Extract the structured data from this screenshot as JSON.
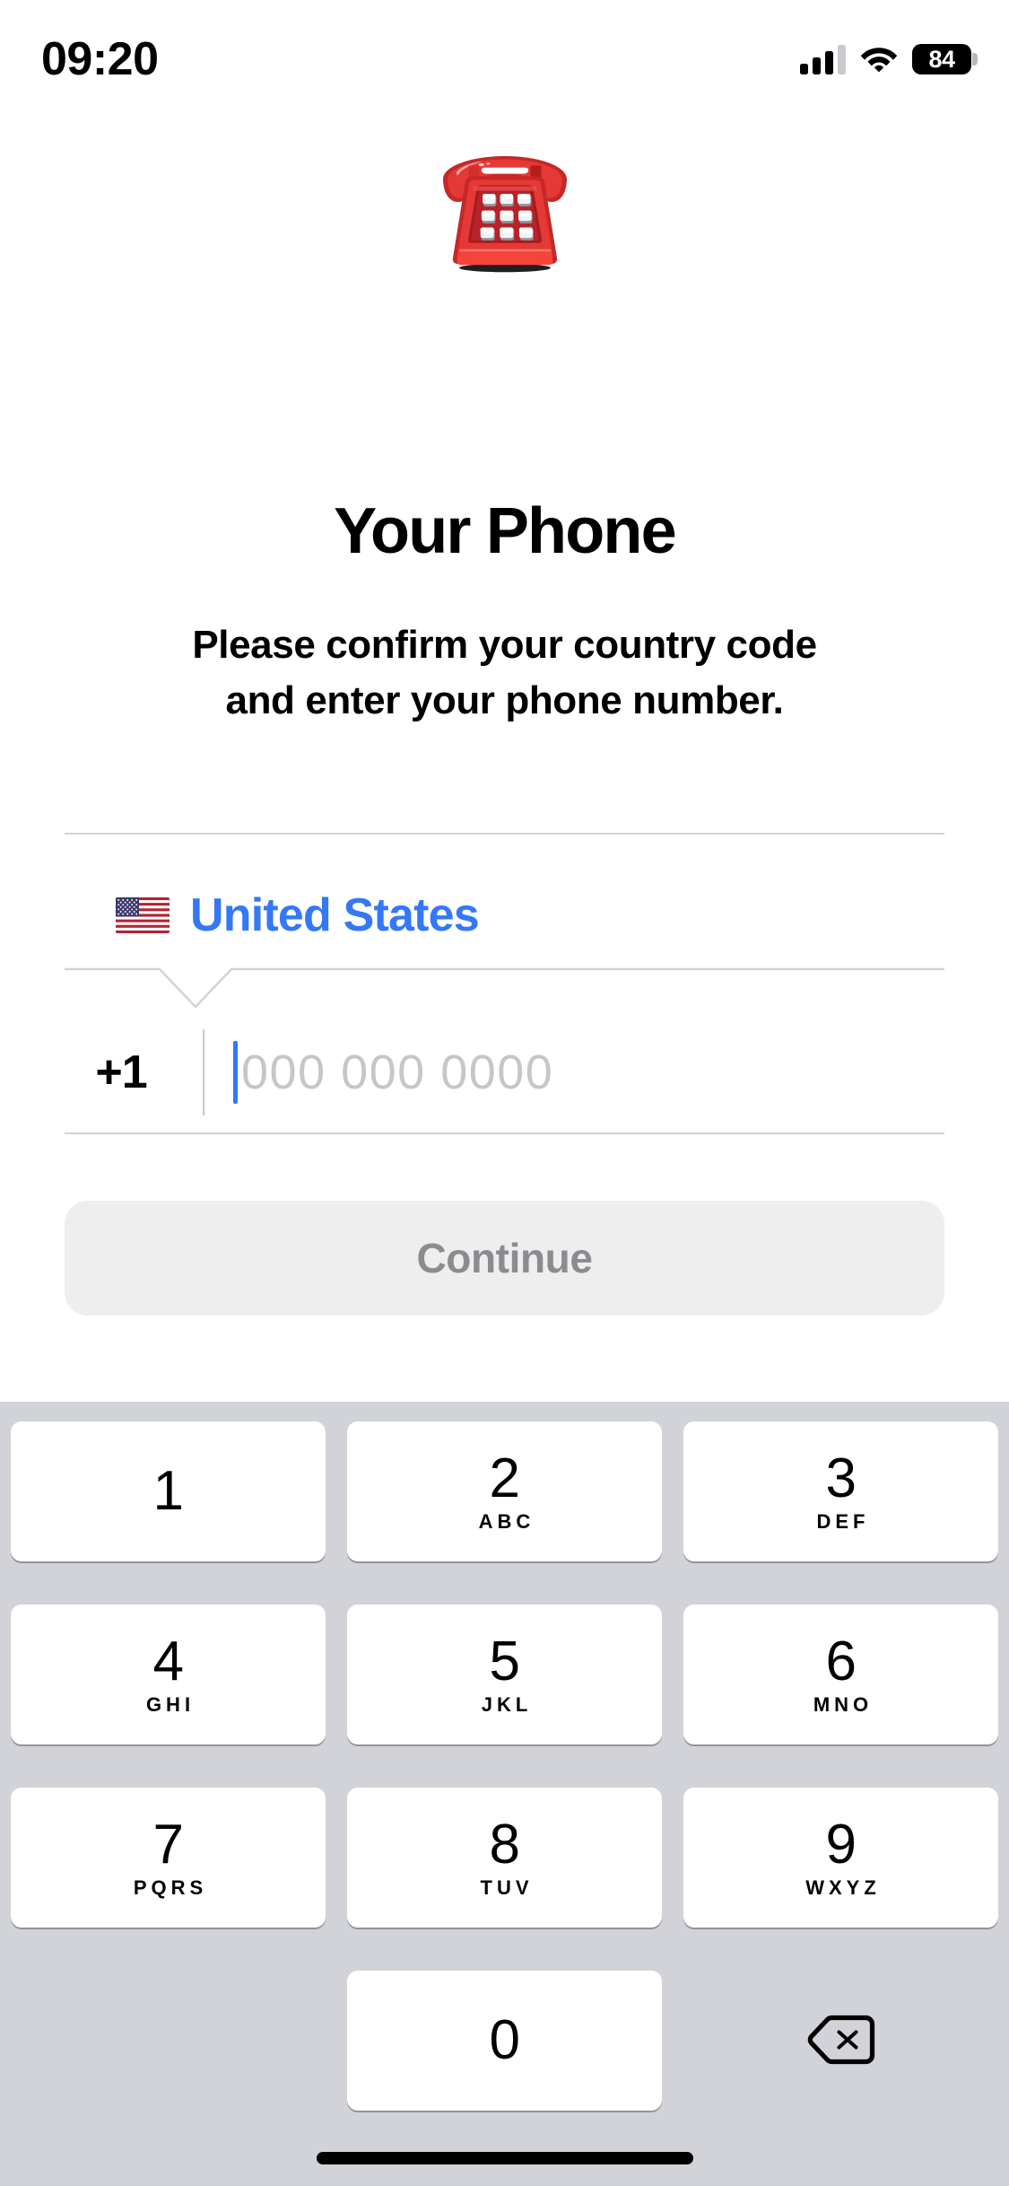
{
  "status_bar": {
    "time": "09:20",
    "battery_percent": "84",
    "signal_icon": "cellular-signal-icon",
    "wifi_icon": "wifi-icon",
    "battery_icon": "battery-icon"
  },
  "hero": {
    "emoji_name": "telephone-emoji",
    "emoji": "☎️"
  },
  "content": {
    "title": "Your Phone",
    "subtitle_line1": "Please confirm your country code",
    "subtitle_line2": "and enter your phone number."
  },
  "form": {
    "country": {
      "flag_name": "united-states-flag-emoji",
      "flag": "🇺🇸",
      "name": "United States",
      "color": "#3478f6"
    },
    "phone": {
      "dial_code": "+1",
      "value": "",
      "placeholder": "000 000 0000"
    }
  },
  "actions": {
    "continue_label": "Continue",
    "continue_enabled": false
  },
  "keypad": {
    "rows": [
      [
        {
          "digit": "1",
          "letters": ""
        },
        {
          "digit": "2",
          "letters": "ABC"
        },
        {
          "digit": "3",
          "letters": "DEF"
        }
      ],
      [
        {
          "digit": "4",
          "letters": "GHI"
        },
        {
          "digit": "5",
          "letters": "JKL"
        },
        {
          "digit": "6",
          "letters": "MNO"
        }
      ],
      [
        {
          "digit": "7",
          "letters": "PQRS"
        },
        {
          "digit": "8",
          "letters": "TUV"
        },
        {
          "digit": "9",
          "letters": "WXYZ"
        }
      ]
    ],
    "zero": {
      "digit": "0",
      "letters": ""
    },
    "delete_icon": "backspace-delete-icon",
    "background_color": "#d1d3d9"
  },
  "home_indicator": "home-indicator"
}
